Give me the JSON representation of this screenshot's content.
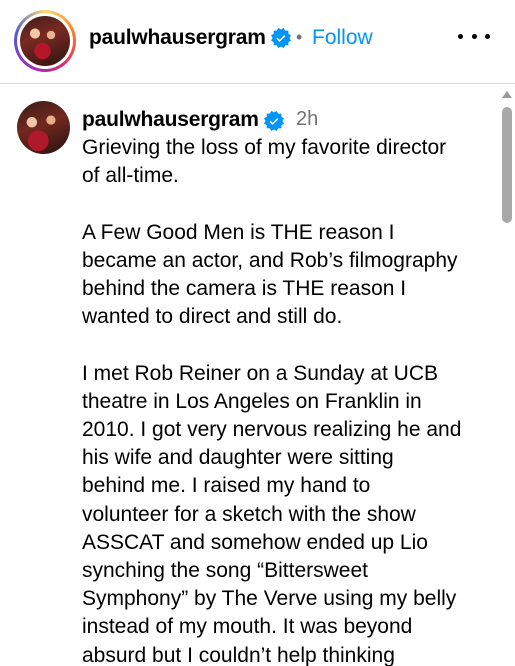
{
  "header": {
    "username": "paulwhausergram",
    "separator": "•",
    "follow_label": "Follow",
    "verified_icon": "verified-badge-icon",
    "more_icon": "more-options-icon"
  },
  "post": {
    "username": "paulwhausergram",
    "timestamp": "2h",
    "caption": "Grieving the loss of my favorite director\nof all-time.\n\nA Few Good Men is THE reason I\nbecame an actor, and Rob’s filmography\nbehind the camera is THE reason I\nwanted to direct and still do.\n\nI met Rob Reiner on a Sunday at UCB\ntheatre in Los Angeles on Franklin in\n2010. I got very nervous realizing he and\nhis wife and daughter were sitting\nbehind me. I raised my hand to\nvolunteer for a sketch with the show\nASSCAT and somehow ended up Lio\nsynching the song “Bittersweet\nSymphony” by The Verve using my belly\ninstead of my mouth. It was beyond\nabsurd but I couldn’t help thinking"
  },
  "colors": {
    "link_blue": "#0095f6",
    "muted_gray": "#737373",
    "verified_blue": "#0095f6",
    "divider": "#dbdbdb"
  }
}
